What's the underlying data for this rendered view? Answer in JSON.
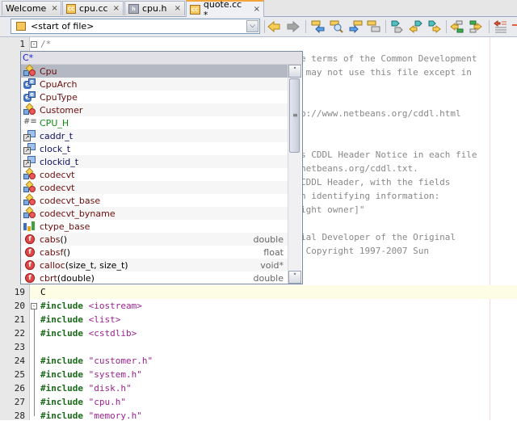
{
  "tabs": [
    {
      "label": "Welcome",
      "icon": null,
      "active": false
    },
    {
      "label": "cpu.cc",
      "icon": "cc-file-icon",
      "active": false
    },
    {
      "label": "cpu.h",
      "icon": "h-file-icon",
      "active": false
    },
    {
      "label": "quote.cc *",
      "icon": "cc-file-icon",
      "active": true
    }
  ],
  "tab_close_glyph": "×",
  "toolbar": {
    "navigator_value": "<start of file>",
    "navigator_dropdown_glyph": "⌄",
    "buttons": [
      "back",
      "forward",
      "find-previous-occurrence",
      "find-selection",
      "find-next-occurrence",
      "toggle-highlight-search",
      "toggle-bookmark",
      "previous-bookmark",
      "next-bookmark",
      "shift-line-left",
      "shift-line-right",
      "uncomment"
    ]
  },
  "completion": {
    "prefix": "C*",
    "items": [
      {
        "label": "Cpu",
        "kind": "class",
        "params": "",
        "ret": "",
        "selected": true
      },
      {
        "label": "CpuArch",
        "kind": "enum",
        "params": "",
        "ret": ""
      },
      {
        "label": "CpuType",
        "kind": "enum",
        "params": "",
        "ret": ""
      },
      {
        "label": "Customer",
        "kind": "class",
        "params": "",
        "ret": ""
      },
      {
        "label": "CPU_H",
        "kind": "macro",
        "params": "",
        "ret": ""
      },
      {
        "label": "caddr_t",
        "kind": "typedef",
        "params": "",
        "ret": ""
      },
      {
        "label": "clock_t",
        "kind": "typedef",
        "params": "",
        "ret": ""
      },
      {
        "label": "clockid_t",
        "kind": "typedef",
        "params": "",
        "ret": ""
      },
      {
        "label": "codecvt",
        "kind": "class",
        "params": "",
        "ret": ""
      },
      {
        "label": "codecvt",
        "kind": "class",
        "params": "",
        "ret": ""
      },
      {
        "label": "codecvt_base",
        "kind": "class",
        "params": "",
        "ret": ""
      },
      {
        "label": "codecvt_byname",
        "kind": "class",
        "params": "",
        "ret": ""
      },
      {
        "label": "ctype_base",
        "kind": "struct",
        "params": "",
        "ret": ""
      },
      {
        "label": "cabs",
        "kind": "function",
        "params": "()",
        "ret": "double"
      },
      {
        "label": "cabsf",
        "kind": "function",
        "params": "()",
        "ret": "float"
      },
      {
        "label": "calloc",
        "kind": "function",
        "params": "(size_t, size_t)",
        "ret": "void*"
      },
      {
        "label": "cbrt",
        "kind": "function",
        "params": "(double)",
        "ret": "double"
      }
    ],
    "scroll_up_glyph": "▲",
    "scroll_down_glyph": "▼"
  },
  "editor": {
    "gutter_numbers": [
      "1",
      "1",
      "1",
      "1",
      "1",
      "1",
      "1",
      "1",
      "1",
      "1",
      "19",
      "20",
      "21",
      "22",
      "23",
      "24",
      "25",
      "26",
      "27",
      "28"
    ],
    "visible_comment_fragments": [
      "/*",
      "e terms of the Common Development",
      " may not use this file except in",
      "p://www.netbeans.org/cddl.html",
      "s CDDL Header Notice in each file",
      "netbeans.org/cddl.txt.",
      "CDDL Header, with the fields",
      "n identifying information:",
      "ight owner]\"",
      "ial Developer of the Original",
      " Copyright 1997-2007 Sun"
    ],
    "current_line_text": "C",
    "includes": [
      {
        "line": "20",
        "kw": "#include",
        "arg": "<iostream>"
      },
      {
        "line": "21",
        "kw": "#include",
        "arg": "<list>"
      },
      {
        "line": "22",
        "kw": "#include",
        "arg": "<cstdlib>"
      },
      {
        "line": "23",
        "kw": "",
        "arg": ""
      },
      {
        "line": "24",
        "kw": "#include",
        "arg": "\"customer.h\""
      },
      {
        "line": "25",
        "kw": "#include",
        "arg": "\"system.h\""
      },
      {
        "line": "26",
        "kw": "#include",
        "arg": "\"disk.h\""
      },
      {
        "line": "27",
        "kw": "#include",
        "arg": "\"cpu.h\""
      },
      {
        "line": "28",
        "kw": "#include",
        "arg": "\"memory.h\""
      }
    ]
  }
}
